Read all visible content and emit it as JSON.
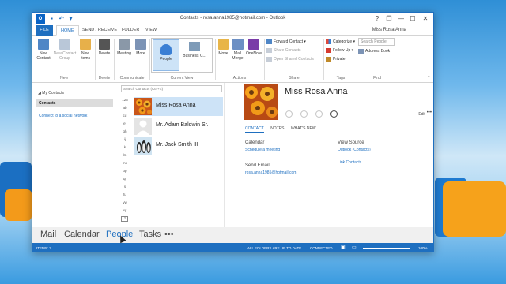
{
  "window": {
    "title": "Contacts - rosa.anna1985@hotmail.com - Outlook",
    "app_icon": "O",
    "quick_access": [
      "save-icon",
      "undo-icon",
      "customize-icon"
    ],
    "controls": {
      "help": "?",
      "restore": "❐",
      "minimize": "—",
      "maximize": "☐",
      "close": "✕"
    }
  },
  "tabs": {
    "file": "FILE",
    "items": [
      "HOME",
      "SEND / RECEIVE",
      "FOLDER",
      "VIEW"
    ],
    "active": "HOME",
    "user": "Miss Rosa Anna"
  },
  "ribbon": {
    "new_group": {
      "new_contact": "New Contact",
      "new_contact_group": "New Contact Group",
      "new_items": "New Items",
      "label": "New"
    },
    "delete_group": {
      "delete": "Delete",
      "label": "Delete"
    },
    "communicate_group": {
      "meeting": "Meeting",
      "more": "More",
      "label": "Communicate"
    },
    "current_view": {
      "people": "People",
      "business_card": "Business C...",
      "label": "Current View"
    },
    "actions_group": {
      "move": "Move",
      "mail_merge": "Mail Merge",
      "onenote": "OneNote",
      "label": "Actions"
    },
    "share_group": {
      "forward_contact": "Forward Contact",
      "share_contacts": "Share Contacts",
      "open_shared": "Open Shared Contacts",
      "label": "Share"
    },
    "tags_group": {
      "categorize": "Categorize",
      "follow_up": "Follow Up",
      "private": "Private",
      "label": "Tags"
    },
    "find_group": {
      "search_people": "Search People",
      "address_book": "Address Book",
      "label": "Find"
    }
  },
  "nav": {
    "my_contacts": "◢ My Contacts",
    "contacts": "Contacts",
    "connect": "Connect to a social network"
  },
  "list": {
    "search_placeholder": "Search Contacts (Ctrl+E)",
    "alpha": [
      "123",
      "ab",
      "cd",
      "ef",
      "gh",
      "ij",
      "k",
      "lm",
      "mn",
      "op",
      "qr",
      "s",
      "tu",
      "vw",
      "xy",
      "z"
    ],
    "contacts": [
      {
        "name": "Miss Rosa Anna",
        "selected": true
      },
      {
        "name": "Mr. Adam Baldwin Sr.",
        "selected": false
      },
      {
        "name": "Mr. Jack Smith III",
        "selected": false
      }
    ]
  },
  "reading": {
    "name": "Miss Rosa Anna",
    "edit": "Edit",
    "more": "•••",
    "tabs": [
      "CONTACT",
      "NOTES",
      "WHAT'S NEW"
    ],
    "calendar_label": "Calendar",
    "schedule_meeting": "Schedule a meeting",
    "send_email_label": "Send Email",
    "email": "rosa.anna1985@hotmail.com",
    "view_source_label": "View Source",
    "outlook_contacts": "Outlook (Contacts)",
    "link_contacts": "Link Contacts..."
  },
  "bottom_nav": [
    "Mail",
    "Calendar",
    "People",
    "Tasks",
    "•••"
  ],
  "bottom_nav_active": "People",
  "status": {
    "items": "ITEMS: 3",
    "sync": "ALL FOLDERS ARE UP TO DATE.",
    "connection": "CONNECTED",
    "zoom": "100%"
  },
  "colors": {
    "accent": "#1e6fc0",
    "selection": "#cde3f7"
  }
}
